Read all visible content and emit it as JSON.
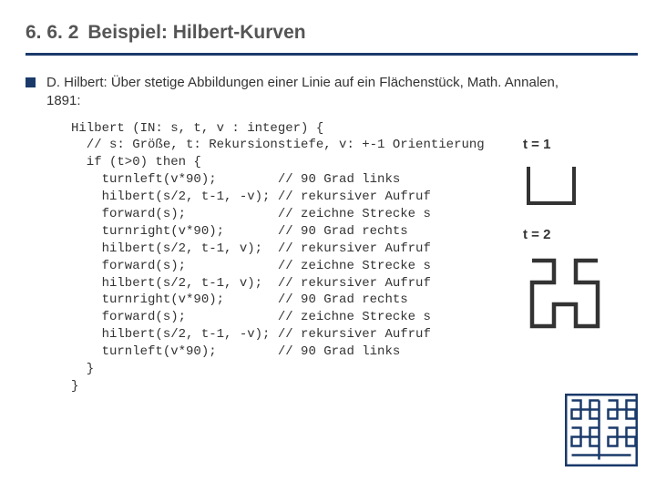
{
  "heading": {
    "number": "6. 6. 2",
    "title": "Beispiel: Hilbert-Kurven"
  },
  "intro": "D. Hilbert: Über stetige Abbildungen einer Linie auf ein Flächenstück, Math. Annalen, 1891:",
  "code": "Hilbert (IN: s, t, v : integer) {\n  // s: Größe, t: Rekursionstiefe, v: +-1 Orientierung\n  if (t>0) then {\n    turnleft(v*90);        // 90 Grad links\n    hilbert(s/2, t-1, -v); // rekursiver Aufruf\n    forward(s);            // zeichne Strecke s\n    turnright(v*90);       // 90 Grad rechts\n    hilbert(s/2, t-1, v);  // rekursiver Aufruf\n    forward(s);            // zeichne Strecke s\n    hilbert(s/2, t-1, v);  // rekursiver Aufruf\n    turnright(v*90);       // 90 Grad rechts\n    forward(s);            // zeichne Strecke s\n    hilbert(s/2, t-1, -v); // rekursiver Aufruf\n    turnleft(v*90);        // 90 Grad links\n  }\n}",
  "figures": {
    "label1": "t = 1",
    "label2": "t = 2"
  }
}
